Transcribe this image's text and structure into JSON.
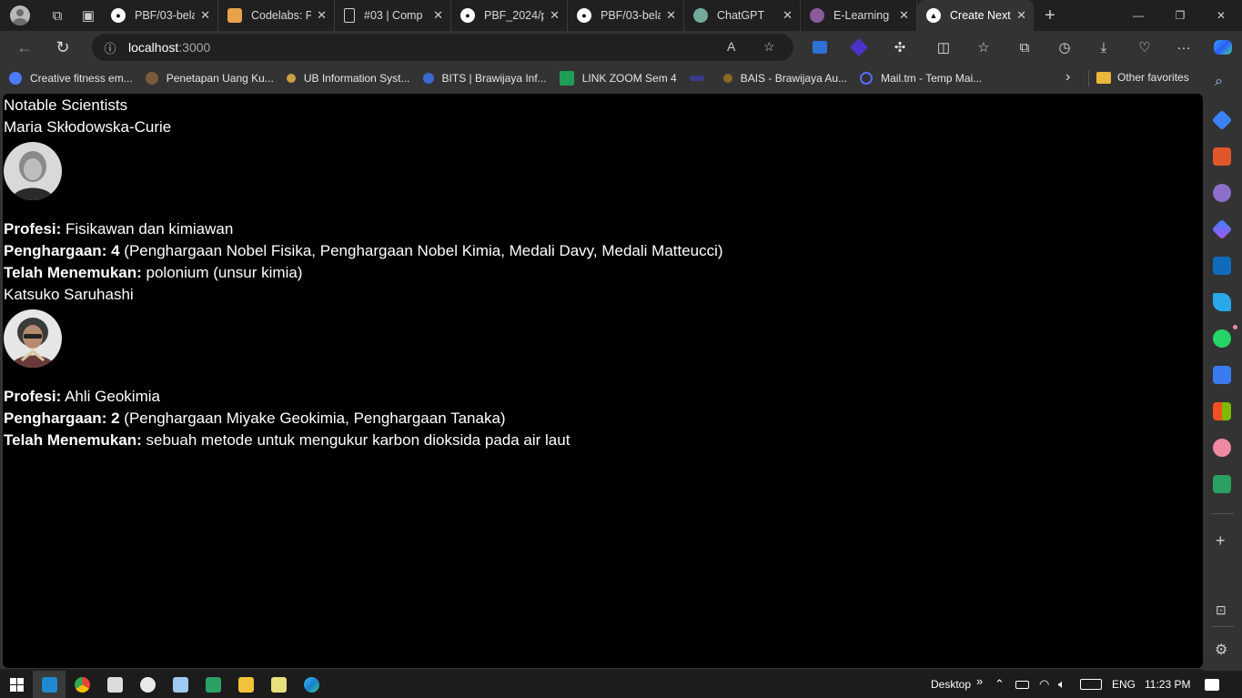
{
  "browser": {
    "tabs": [
      {
        "label": "PBF/03-bela",
        "icon": "github-icon",
        "color": "#ffffff"
      },
      {
        "label": "Codelabs: Pe",
        "icon": "codelabs-icon",
        "color": "#e8a24a"
      },
      {
        "label": "#03 | Comp",
        "icon": "document-icon",
        "color": "#d0d0d0"
      },
      {
        "label": "PBF_2024/p",
        "icon": "github-icon",
        "color": "#ffffff"
      },
      {
        "label": "PBF/03-bela",
        "icon": "github-icon",
        "color": "#ffffff"
      },
      {
        "label": "ChatGPT",
        "icon": "chatgpt-icon",
        "color": "#74aa9c"
      },
      {
        "label": "E-Learning",
        "icon": "elearning-icon",
        "color": "#8c5b9b"
      },
      {
        "label": "Create Next",
        "icon": "nextjs-icon",
        "color": "#000000"
      }
    ],
    "address": {
      "host": "localhost",
      "port": ":3000"
    },
    "bookmarks": [
      {
        "label": "Creative fitness em...",
        "color": "#4a7bff"
      },
      {
        "label": "Penetapan Uang Ku...",
        "color": "#7a5a3a"
      },
      {
        "label": "UB Information Syst...",
        "color": "#c8a040"
      },
      {
        "label": "BITS | Brawijaya Inf...",
        "color": "#3a6ad0"
      },
      {
        "label": "LINK ZOOM Sem 4",
        "color": "#1f9d55"
      },
      {
        "label": "",
        "color": "#3a3a8a"
      },
      {
        "label": "BAIS - Brawijaya Au...",
        "color": "#8a6a20"
      },
      {
        "label": "Mail.tm - Temp Mai...",
        "color": "#5a6aff"
      }
    ],
    "other_favorites": "Other favorites"
  },
  "page": {
    "title": "Notable Scientists",
    "scientists": [
      {
        "name": "Maria Skłodowska-Curie",
        "profession_label": "Profesi:",
        "profession": "Fisikawan dan kimiawan",
        "awards_label": "Penghargaan: 4",
        "awards": "(Penghargaan Nobel Fisika, Penghargaan Nobel Kimia, Medali Davy, Medali Matteucci)",
        "discovered_label": "Telah Menemukan:",
        "discovered": "polonium (unsur kimia)"
      },
      {
        "name": "Katsuko Saruhashi",
        "profession_label": "Profesi:",
        "profession": "Ahli Geokimia",
        "awards_label": "Penghargaan: 2",
        "awards": "(Penghargaan Miyake Geokimia, Penghargaan Tanaka)",
        "discovered_label": "Telah Menemukan:",
        "discovered": "sebuah metode untuk mengukur karbon dioksida pada air laut"
      }
    ]
  },
  "taskbar": {
    "desktop": "Desktop",
    "lang": "ENG",
    "time": "11:23 PM"
  }
}
